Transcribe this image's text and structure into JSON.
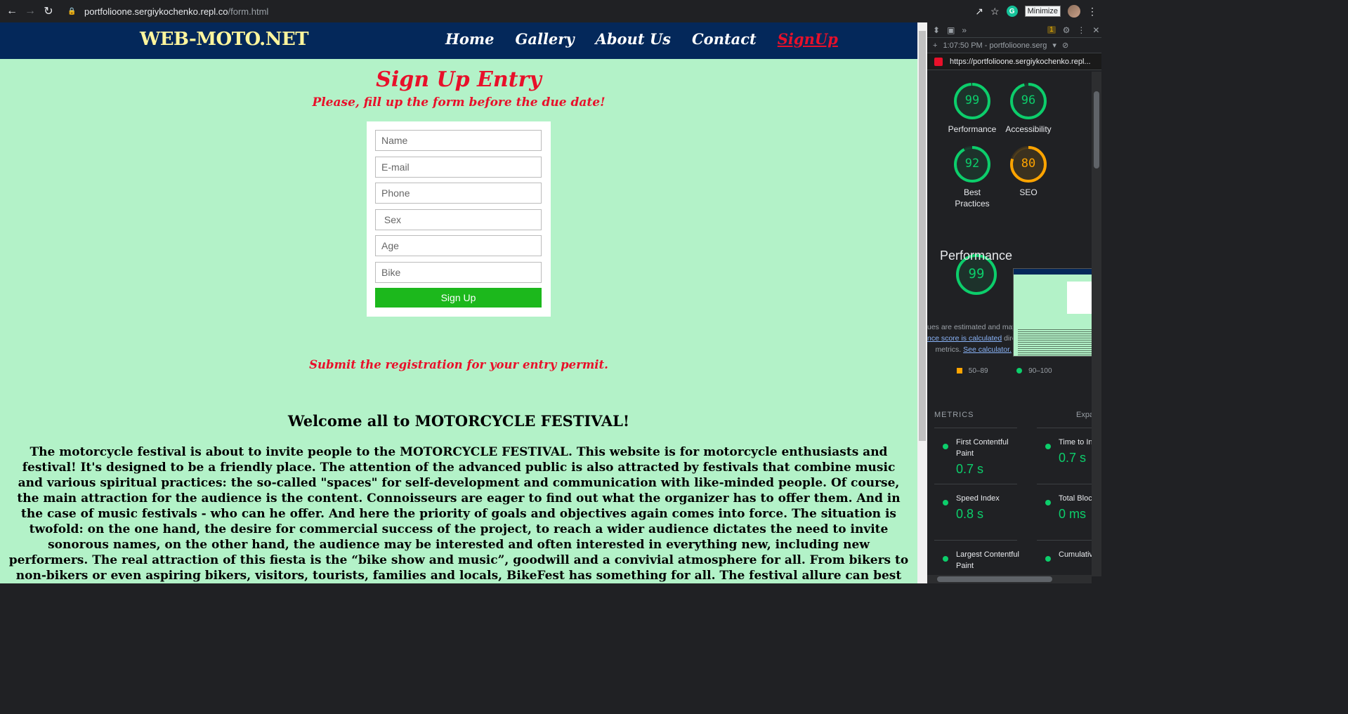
{
  "browser": {
    "url_host": "portfolioone.sergiykochenko.repl.co",
    "url_path": "/form.html",
    "tooltip": "Minimize",
    "extension_badge": "G"
  },
  "site": {
    "logo": "WEB-MOTO.NET",
    "nav": [
      "Home",
      "Gallery",
      "About Us",
      "Contact",
      "SignUp"
    ],
    "active_nav": "SignUp"
  },
  "form": {
    "title": "Sign Up Entry",
    "subtitle": "Please, fill up the form before the due date!",
    "fields": [
      {
        "placeholder": "Name"
      },
      {
        "placeholder": "E-mail"
      },
      {
        "placeholder": "Phone"
      },
      {
        "placeholder": " Sex"
      },
      {
        "placeholder": "Age"
      },
      {
        "placeholder": "Bike"
      }
    ],
    "button": "Sign Up"
  },
  "content": {
    "submit_note": "Submit the registration for your entry permit.",
    "welcome": "Welcome all to MOTORCYCLE FESTIVAL!",
    "body": "The motorcycle festival is about to invite people to the MOTORCYCLE FESTIVAL. This website is for motorcycle enthusiasts and festival! It's designed to be a friendly place. The attention of the advanced public is also attracted by festivals that combine music and various spiritual practices: the so-called \"spaces\" for self-development and communication with like-minded people. Of course, the main attraction for the audience is the content. Connoisseurs are eager to find out what the organizer has to offer them. And in the case of music festivals - who can he offer. And here the priority of goals and objectives again comes into force. The situation is twofold: on the one hand, the desire for commercial success of the project, to reach a wider audience dictates the need to invite sonorous names, on the other hand, the audience may be interested and often interested in everything new, including new performers. The real attraction of this fiesta is the “bike show and music”, goodwill and a convivial atmosphere for all. From bikers to non-bikers or even aspiring bikers, visitors, tourists, families and locals, BikeFest has something for all. The festival allure can best be described by broad smiles and good humour as everyone soaks up the atmosphere in the Bike Camp located hear the town centre, on the Nikolaev Road, in the grounds of the Dom Pavlovyh Hotel. Add in an action-packed, fun-fueled programme of events and activities, lots of live music stages day and"
  },
  "devtools": {
    "issues_count": "1",
    "report_time": "1:07:50 PM - portfolioone.serg",
    "report_url": "https://portfolioone.sergiykochenko.repl...",
    "scores": [
      {
        "label": "Performance",
        "value": 99,
        "color": "#0cce6b"
      },
      {
        "label": "Accessibility",
        "value": 96,
        "color": "#0cce6b"
      },
      {
        "label": "Best\nPractices",
        "value": 92,
        "color": "#0cce6b"
      },
      {
        "label": "SEO",
        "value": 80,
        "color": "#ffa400"
      }
    ],
    "main_score": {
      "label": "Performance",
      "value": 99,
      "color": "#0cce6b"
    },
    "note_line1": "ues are estimated and may va",
    "note_link1": "nce score is calculated",
    "note_after_link1": " direc",
    "note_line3_pre": "metrics. ",
    "note_link2": "See calculator.",
    "legend_mid": "50–89",
    "legend_good": "90–100",
    "metrics_header": "METRICS",
    "metrics_expand": "Expa",
    "metrics": [
      {
        "name": "First Contentful Paint",
        "value": "0.7 s"
      },
      {
        "name": "Time to Inte",
        "value": "0.7 s"
      },
      {
        "name": "Speed Index",
        "value": "0.8 s"
      },
      {
        "name": "Total Block",
        "value": "0 ms"
      },
      {
        "name": "Largest Contentful Paint",
        "value": ""
      },
      {
        "name": "Cumulative Shift",
        "value": ""
      }
    ]
  }
}
